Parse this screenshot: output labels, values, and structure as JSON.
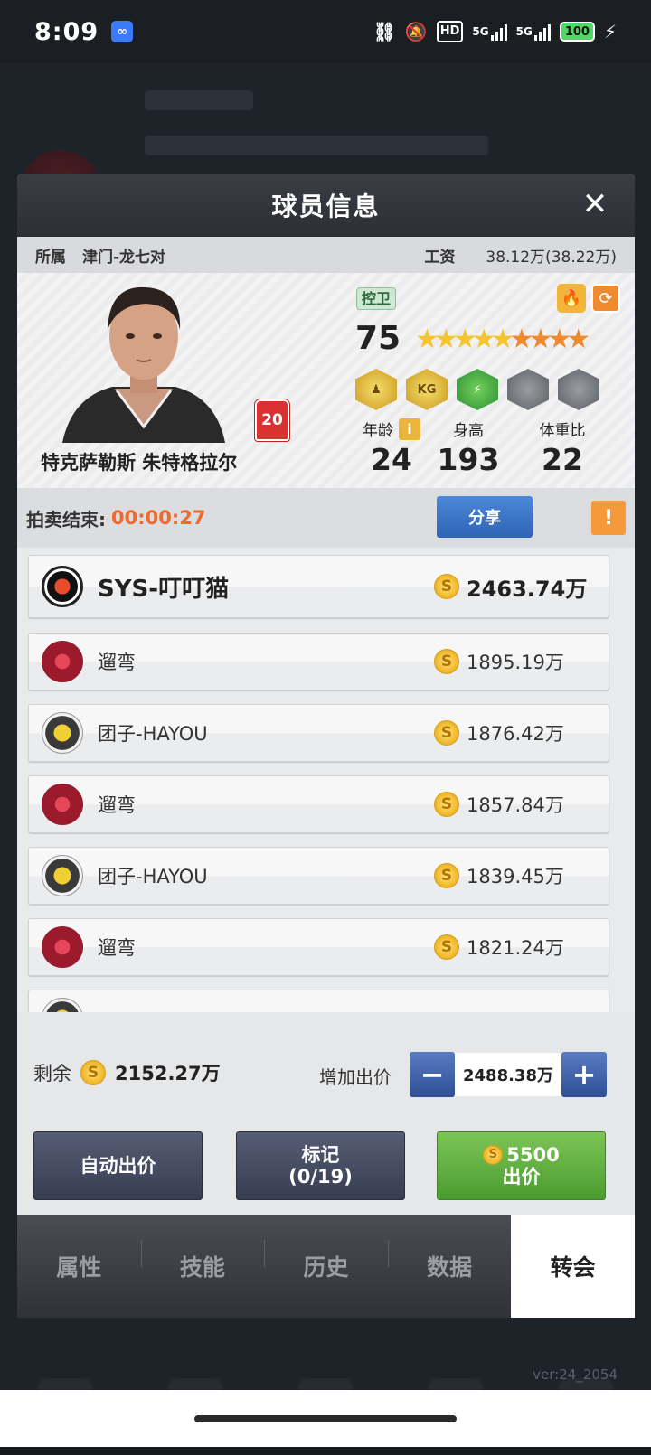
{
  "status_bar": {
    "time": "8:09",
    "network_hd": "HD",
    "signal1": "5G",
    "signal2": "5G",
    "battery": "100"
  },
  "modal": {
    "title": "球员信息",
    "close": "✕"
  },
  "team": {
    "label": "所属",
    "value": "津门-龙七对",
    "salary_label": "工资",
    "salary_value": "38.12万(38.22万)"
  },
  "player": {
    "name": "特克萨勒斯 朱特格拉尔",
    "jersey_number": "20",
    "position": "控卫",
    "rating": "75",
    "stars_gold": 5,
    "stars_orange": 4,
    "skills": [
      "gold-player-skill",
      "kg-skill",
      "green-skill",
      "locked",
      "locked"
    ],
    "age_label": "年龄",
    "age": "24",
    "height_label": "身高",
    "height": "193",
    "weight_label": "体重比",
    "weight": "22"
  },
  "auction": {
    "label": "拍卖结束:",
    "time": "00:00:27",
    "share_label": "分享",
    "warn": "!"
  },
  "bids": [
    {
      "team": "SYS-叮叮猫",
      "amount": "2463.74万",
      "logo": "spartan"
    },
    {
      "team": "遛弯",
      "amount": "1895.19万",
      "logo": "raptor"
    },
    {
      "team": "团子-HAYOU",
      "amount": "1876.42万",
      "logo": "hayou"
    },
    {
      "team": "遛弯",
      "amount": "1857.84万",
      "logo": "raptor"
    },
    {
      "team": "团子-HAYOU",
      "amount": "1839.45万",
      "logo": "hayou"
    },
    {
      "team": "遛弯",
      "amount": "1821.24万",
      "logo": "raptor"
    }
  ],
  "bottom": {
    "remain_label": "剩余",
    "remain_value": "2152.27万",
    "raise_label": "增加出价",
    "raise_value": "2488.38万",
    "minus": "−",
    "plus": "+",
    "auto_bid": "自动出价",
    "mark_line1": "标记",
    "mark_line2": "(0/19)",
    "bid_amount": "5500",
    "bid_label": "出价"
  },
  "tabs": [
    {
      "label": "属性",
      "active": false
    },
    {
      "label": "技能",
      "active": false
    },
    {
      "label": "历史",
      "active": false
    },
    {
      "label": "数据",
      "active": false
    },
    {
      "label": "转会",
      "active": true
    }
  ],
  "version": "ver:24_2054"
}
